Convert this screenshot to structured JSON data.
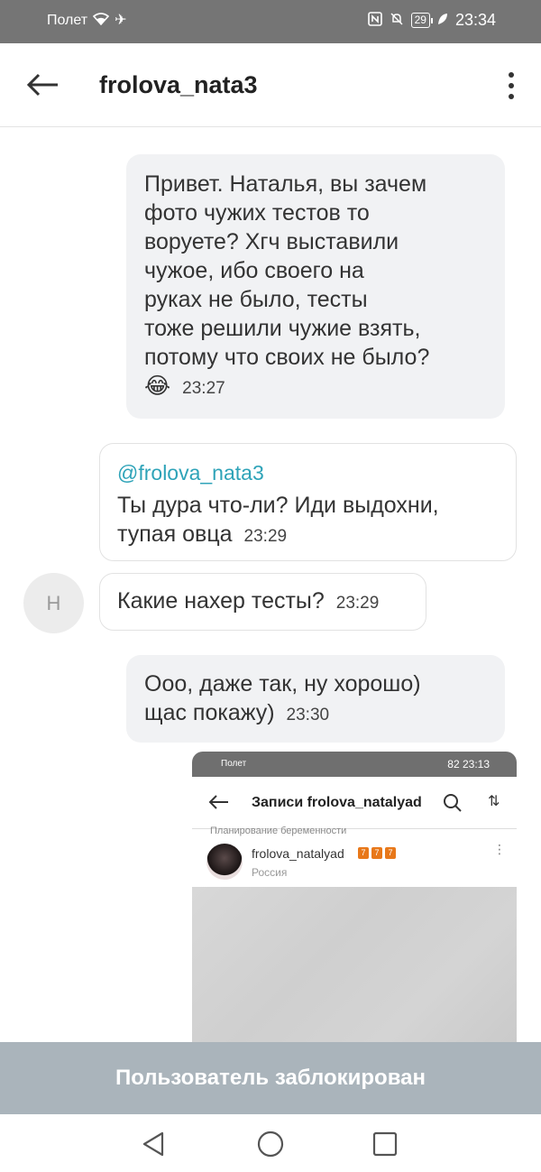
{
  "status_bar": {
    "carrier": "Полет",
    "battery": "29",
    "time": "23:34",
    "icons": [
      "wifi-icon",
      "airplane-icon",
      "nfc-icon",
      "mute-icon",
      "battery-icon",
      "leaf-icon"
    ]
  },
  "app_bar": {
    "title": "frolova_nata3",
    "icons": [
      "back-arrow-icon",
      "more-vertical-icon"
    ]
  },
  "messages": [
    {
      "direction": "outgoing",
      "lines": [
        "Привет. Наталья, вы зачем",
        "фото чужих тестов то",
        "воруете? Хгч выставили",
        "чужое, ибо своего на",
        "руках не было, тесты",
        "тоже решили чужие взять,",
        "потому что своих не было?"
      ],
      "emoji": "😂",
      "time": "23:27"
    },
    {
      "direction": "incoming",
      "mention": "@frolova_nata3",
      "lines": [
        "Ты дура что-ли? Иди выдохни,",
        "тупая овца"
      ],
      "time": "23:29"
    },
    {
      "direction": "incoming",
      "avatar_letter": "Н",
      "lines": [
        "Какие нахер тесты?"
      ],
      "time": "23:29"
    },
    {
      "direction": "outgoing",
      "lines": [
        "Ооо, даже так, ну хорошо)",
        "щас покажу)"
      ],
      "time": "23:30"
    }
  ],
  "screenshot_attachment": {
    "status_carrier": "Полет",
    "status_battery": "82",
    "status_time": "23:13",
    "title": "Записи frolova_natalyad",
    "cut_text": "Планирование беременности",
    "post_author": "frolova_natalyad",
    "post_badges": [
      "7",
      "7",
      "7"
    ],
    "post_location": "Россия"
  },
  "blocked_banner": "Пользователь заблокирован",
  "nav_bar": {
    "icons": [
      "nav-back-icon",
      "nav-home-icon",
      "nav-recents-icon"
    ]
  },
  "colors": {
    "status_bar": "#757575",
    "mention": "#2ea3b8",
    "outgoing_bubble": "#f1f2f4",
    "blocked_banner": "#aab4bb"
  }
}
